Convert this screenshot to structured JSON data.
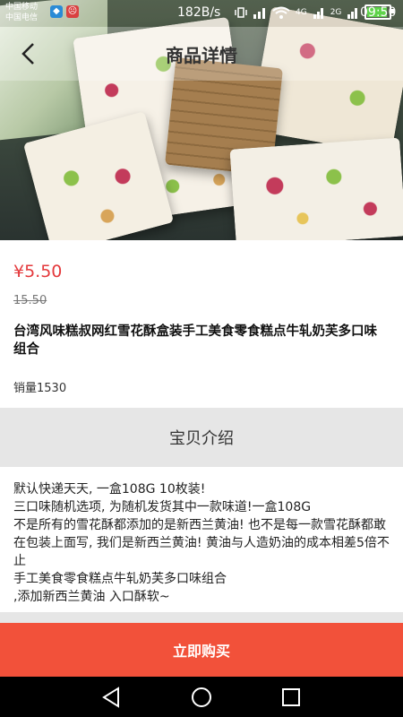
{
  "status_bar": {
    "carrier_1": "中国移动",
    "carrier_2": "中国电信",
    "speed": "182B/s",
    "net_1": "4G",
    "net_2": "2G",
    "time": "09:50"
  },
  "header": {
    "title": "商品详情",
    "back_icon": "back-chevron-icon"
  },
  "product": {
    "price": "¥5.50",
    "original_price": "15.50",
    "title": "台湾风味糕叔网红雪花酥盒装手工美食零食糕点牛轧奶芙多口味组合",
    "sales": "销量1530"
  },
  "section": {
    "title": "宝贝介绍"
  },
  "description": {
    "lines": [
      "默认快递天天, 一盒108G 10枚装!",
      "三口味随机选项, 为随机发货其中一款味道!一盒108G",
      "不是所有的雪花酥都添加的是新西兰黄油! 也不是每一款雪花酥都敢在包装上面写, 我们是新西兰黄油! 黄油与人造奶油的成本相差5倍不止",
      "手工美食零食糕点牛轧奶芙多口味组合",
      ",添加新西兰黄油 入口酥软~"
    ]
  },
  "actions": {
    "buy_now": "立即购买"
  },
  "colors": {
    "accent": "#f2513a",
    "price": "#e4393c",
    "section_bg": "#e6e6e6"
  }
}
